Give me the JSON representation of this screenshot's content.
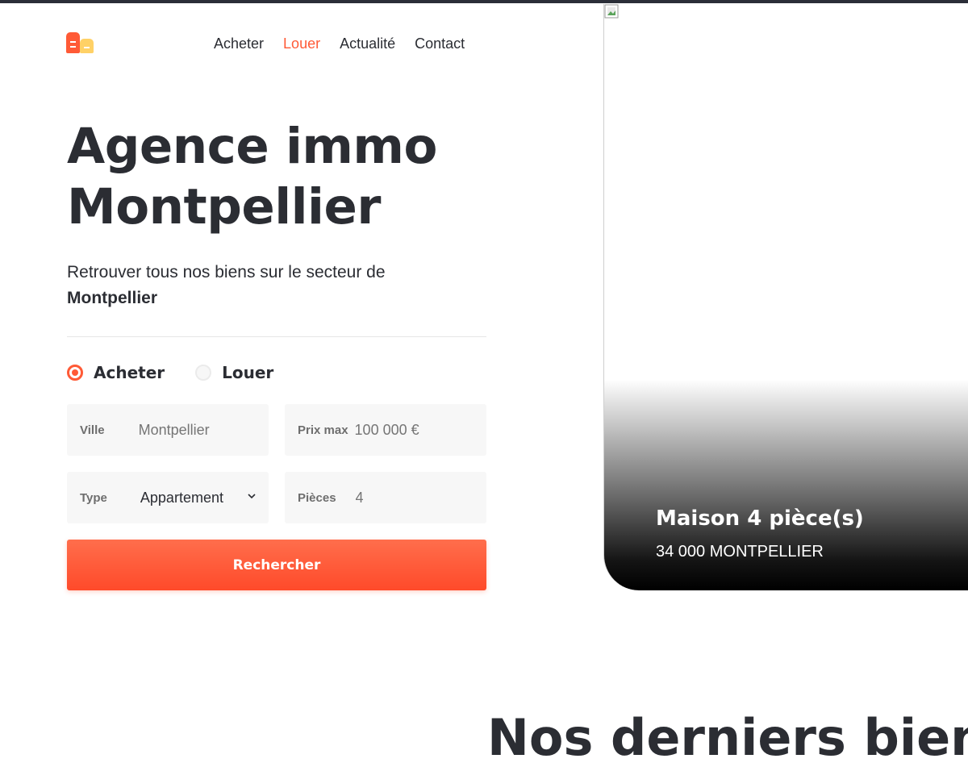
{
  "header": {
    "logo_icon": "houses-logo-icon",
    "nav": [
      {
        "label": "Acheter",
        "active": false
      },
      {
        "label": "Louer",
        "active": true
      },
      {
        "label": "Actualité",
        "active": false
      },
      {
        "label": "Contact",
        "active": false
      }
    ]
  },
  "hero": {
    "title_line1": "Agence immo",
    "title_line2": "Montpellier",
    "subtitle": "Retrouver tous nos biens sur le secteur de",
    "subtitle_bold": "Montpellier"
  },
  "search": {
    "mode_options": [
      {
        "label": "Acheter",
        "checked": true
      },
      {
        "label": "Louer",
        "checked": false
      }
    ],
    "ville": {
      "label": "Ville",
      "placeholder": "Montpellier"
    },
    "prix": {
      "label": "Prix max",
      "placeholder": "100 000 €"
    },
    "type": {
      "label": "Type",
      "value": "Appartement"
    },
    "pieces": {
      "label": "Pièces",
      "placeholder": "4"
    },
    "submit_label": "Rechercher"
  },
  "featured": {
    "title": "Maison 4 pièce(s)",
    "location": "34 000 MONTPELLIER"
  },
  "next_section": {
    "heading": "Nos derniers biens"
  },
  "colors": {
    "accent": "#ff5a36",
    "logo_secondary": "#ffd166",
    "text": "#2b2d33",
    "field_bg": "#f7f7f7"
  }
}
